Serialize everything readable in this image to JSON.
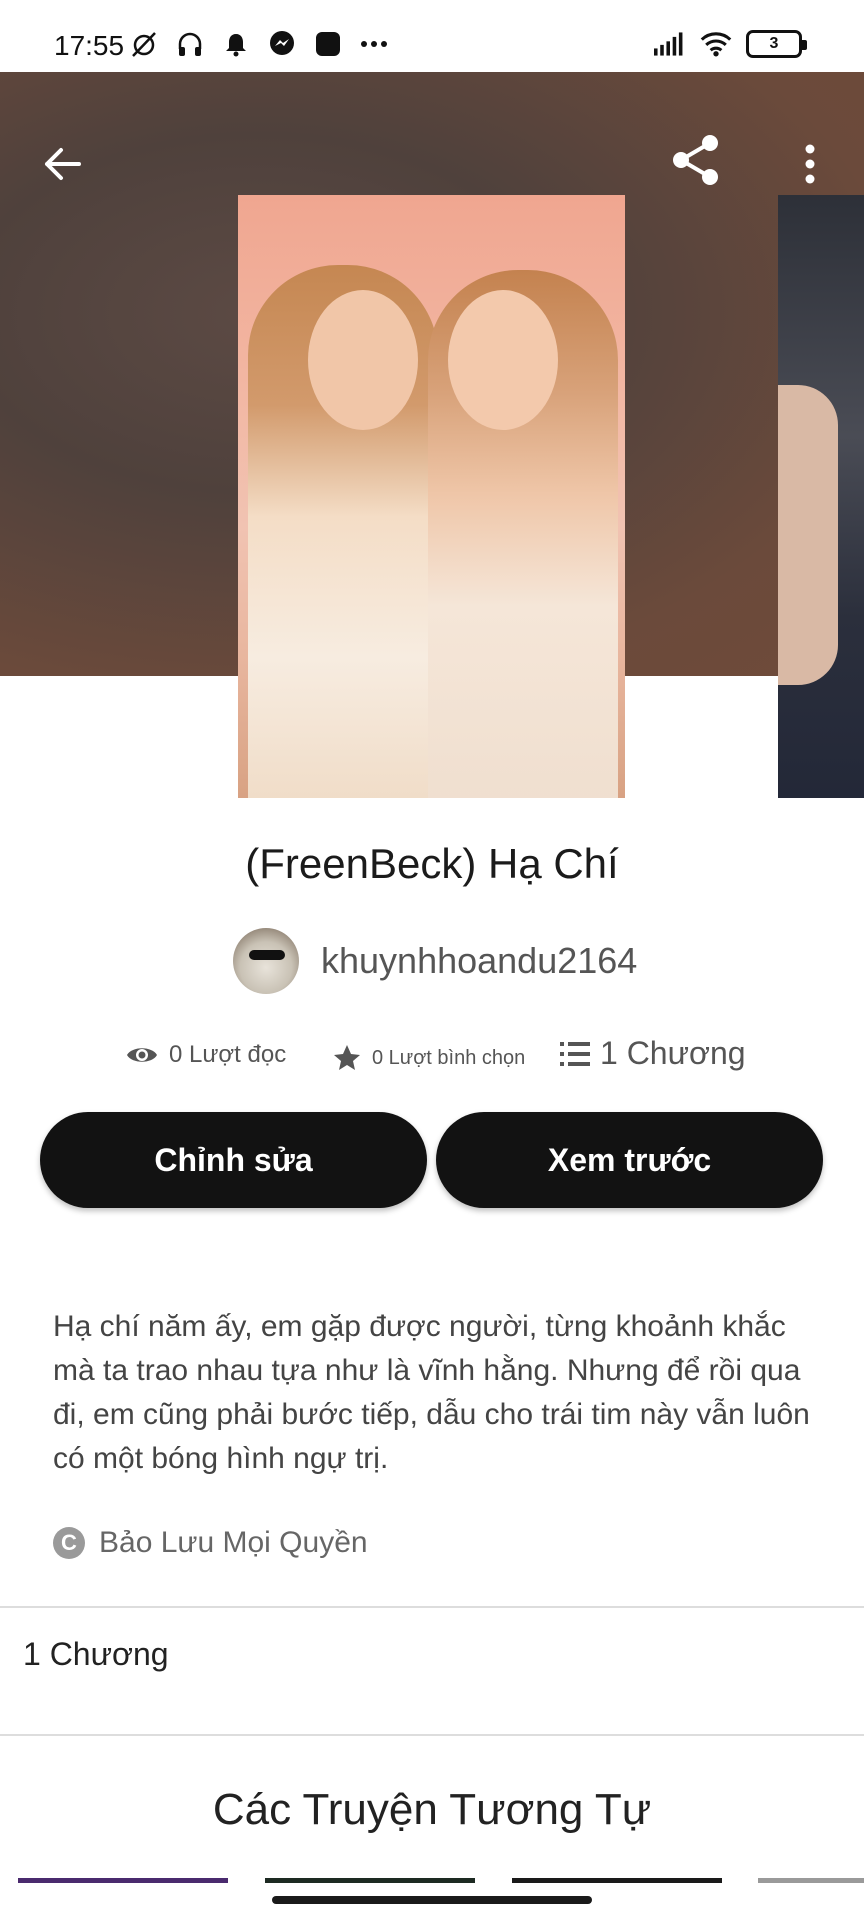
{
  "status_bar": {
    "time": "17:55",
    "battery": "3",
    "left_icons": [
      "mute-alarm-icon",
      "headphones-icon",
      "bell-icon",
      "messenger-icon",
      "app-square-icon",
      "more-dots-icon"
    ],
    "right_icons": [
      "signal-icon",
      "wifi-icon",
      "battery-icon"
    ]
  },
  "hero": {
    "back_icon": "arrow-left-icon",
    "share_icon": "share-icon",
    "more_icon": "more-vertical-icon"
  },
  "story": {
    "title": "(FreenBeck) Hạ Chí",
    "author": "khuynhhoandu2164",
    "stats": {
      "reads": "0 Lượt đọc",
      "votes": "0 Lượt bình chọn",
      "chapters": "1 Chương"
    },
    "description": "Hạ chí năm ấy, em gặp được người, từng khoảnh khắc mà ta trao nhau tựa như là vĩnh hằng. Nhưng để rồi qua đi, em cũng phải bước tiếp, dẫu cho trái tim này vẫn luôn có một bóng hình ngự trị.",
    "copyright": "Bảo Lưu Mọi Quyền"
  },
  "actions": {
    "edit_label": "Chỉnh sửa",
    "preview_label": "Xem trước"
  },
  "chapters_section": {
    "label": "1 Chương"
  },
  "similar": {
    "title": "Các Truyện Tương Tự"
  },
  "colors": {
    "button_bg": "#121212",
    "hero_bg": "#5a4640",
    "accent": "#4a2a6e"
  }
}
